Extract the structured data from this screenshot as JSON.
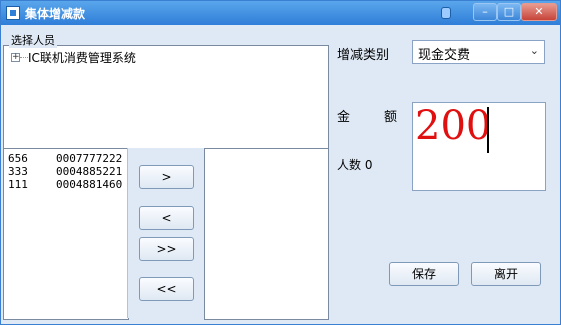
{
  "window": {
    "title": "集体增减款",
    "controls": {
      "minimize": "–",
      "maximize": "□",
      "close": "✕"
    }
  },
  "select_people": {
    "legend": "选择人员",
    "tree_root": "IC联机消费管理系统",
    "expander": "+"
  },
  "selected_list": [
    {
      "id": "656",
      "card": "0007777222"
    },
    {
      "id": "333",
      "card": "0004885221"
    },
    {
      "id": "111",
      "card": "0004881460"
    }
  ],
  "transfer_buttons": {
    "add": ">",
    "remove": "<",
    "add_all": ">>",
    "remove_all": "<<"
  },
  "form": {
    "type_label": "增减类别",
    "type_value": "现金交费",
    "amount_label_1": "金",
    "amount_label_2": "额",
    "amount_value": "200",
    "people_count": "人数 0"
  },
  "actions": {
    "save": "保存",
    "leave": "离开"
  }
}
